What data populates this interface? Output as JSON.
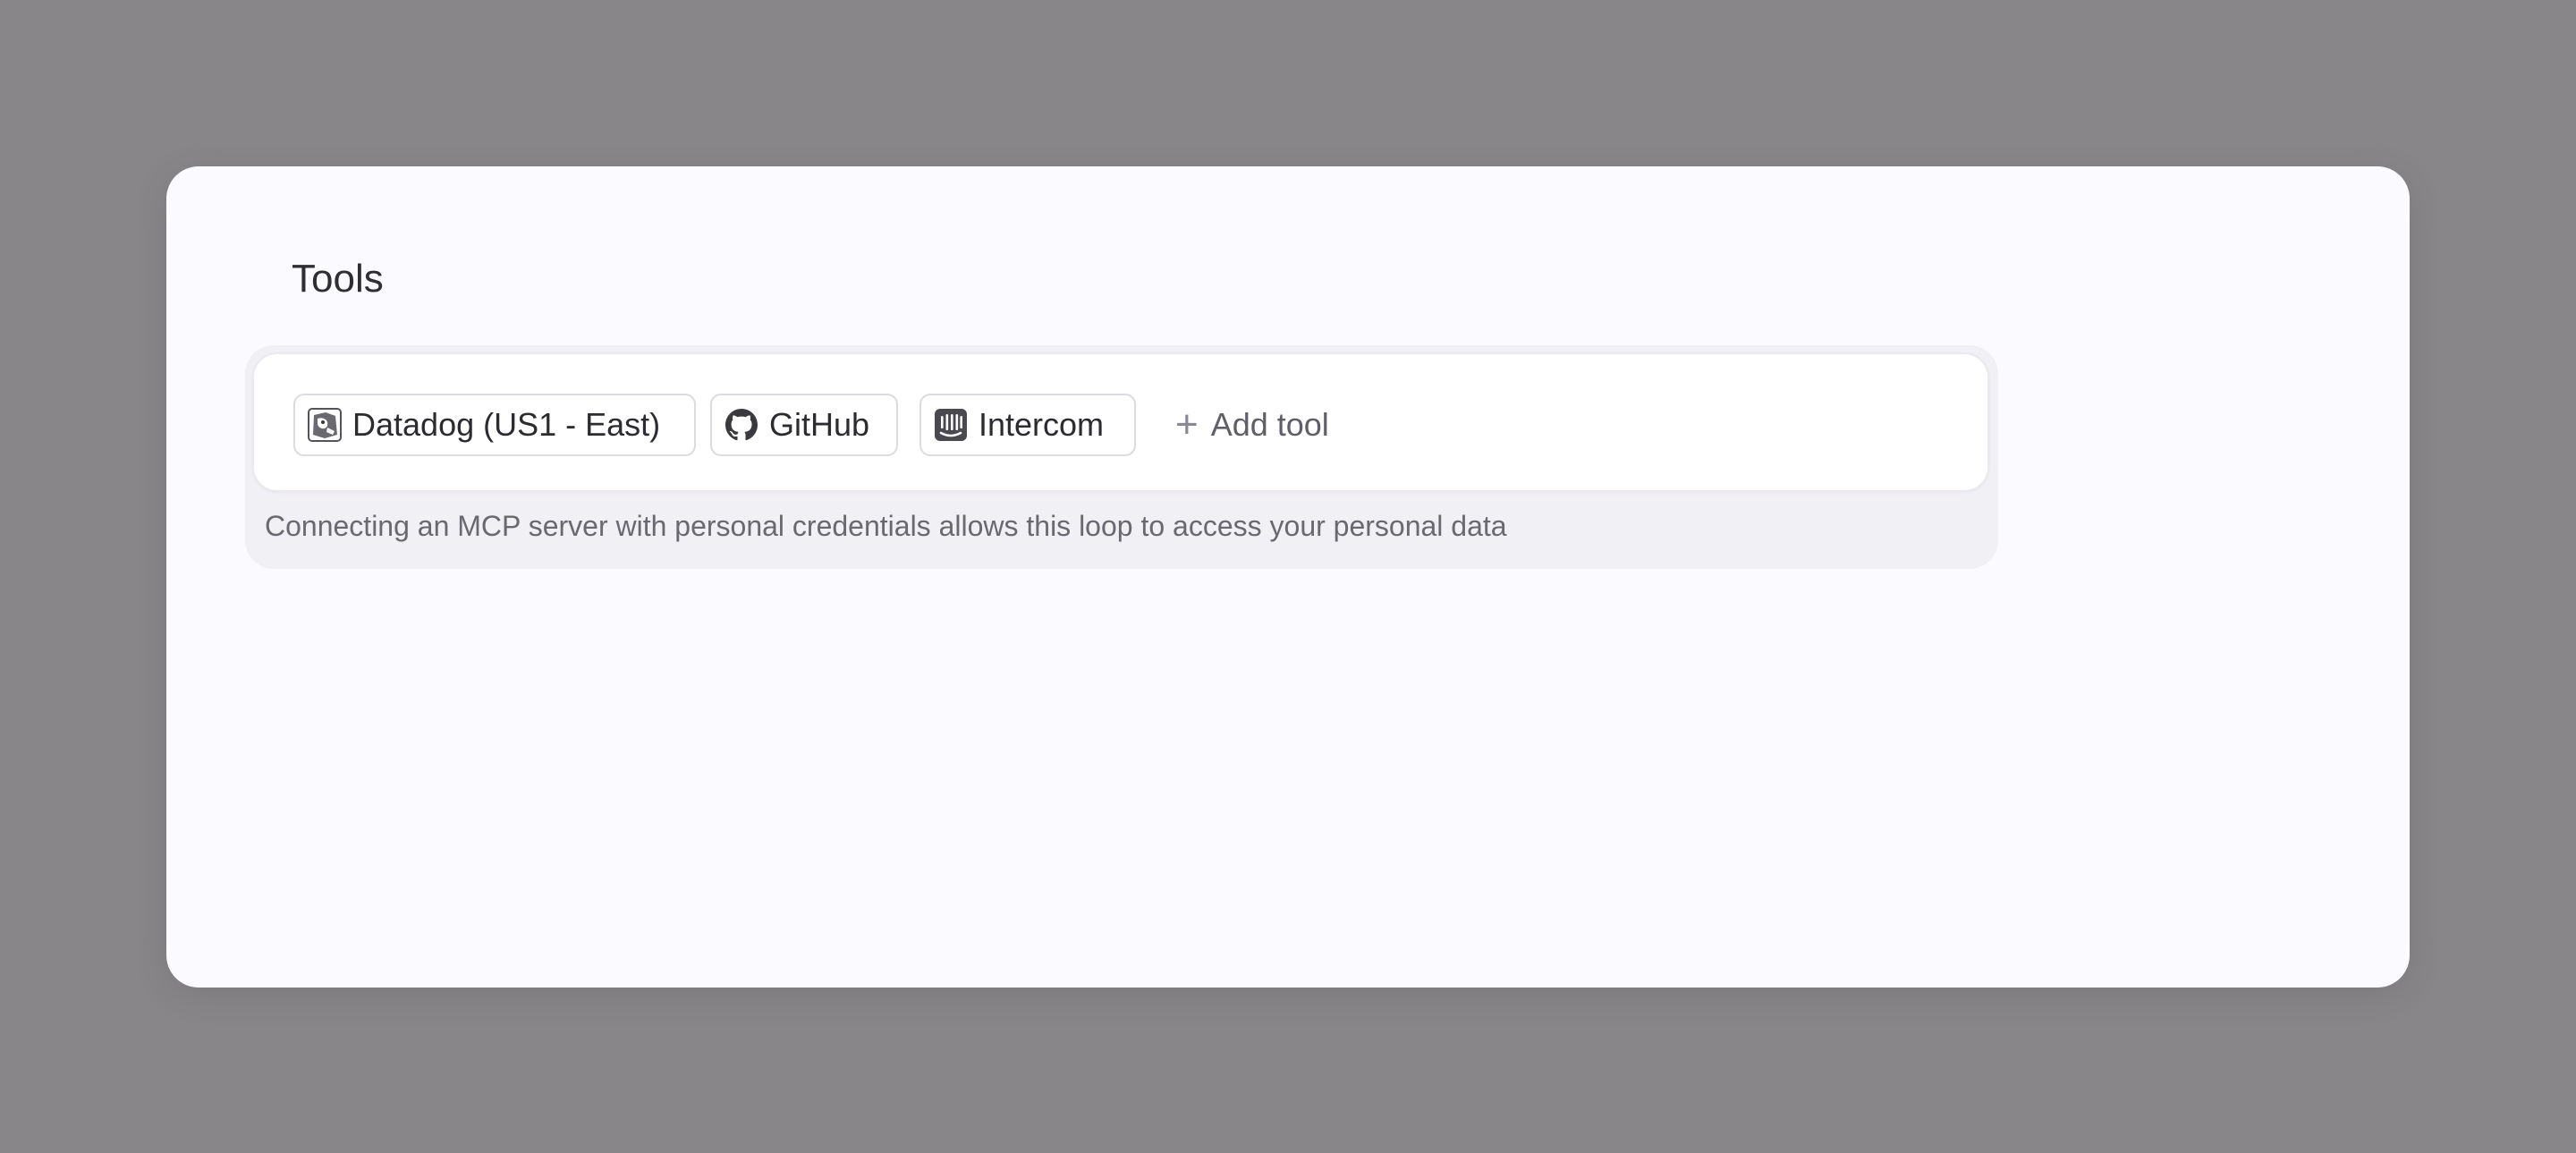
{
  "section": {
    "title": "Tools"
  },
  "tools": [
    {
      "label": "Datadog (US1 - East)",
      "icon": "datadog-icon"
    },
    {
      "label": "GitHub",
      "icon": "github-icon"
    },
    {
      "label": "Intercom",
      "icon": "intercom-icon"
    }
  ],
  "add_tool": {
    "label": "Add tool",
    "icon": "plus-icon"
  },
  "notice": "Connecting an MCP server with personal credentials allows this loop to access your personal data",
  "colors": {
    "backdrop": "#888689",
    "card": "#fbfaff",
    "chip_border": "#dcdbe0",
    "text": "#2c2b30",
    "muted_text": "#6a6870"
  }
}
